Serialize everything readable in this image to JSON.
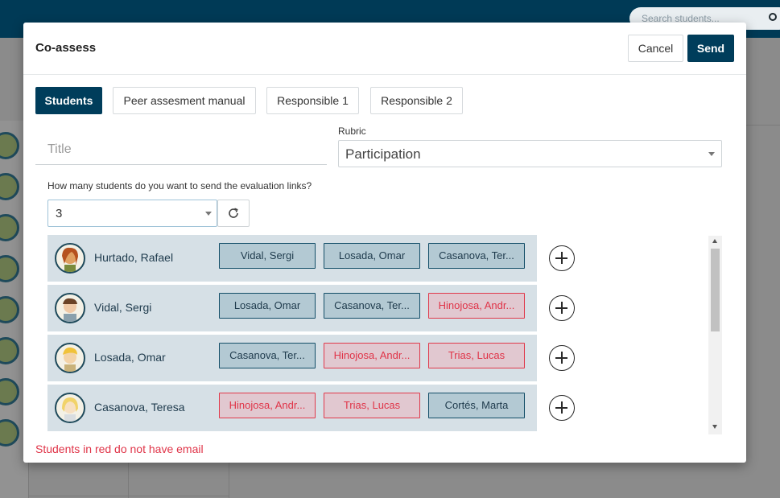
{
  "background": {
    "search_placeholder": "Search students..."
  },
  "modal": {
    "title": "Co-assess",
    "cancel_label": "Cancel",
    "send_label": "Send",
    "tabs": [
      {
        "label": "Students",
        "active": true
      },
      {
        "label": "Peer assesment manual",
        "active": false
      },
      {
        "label": "Responsible 1",
        "active": false
      },
      {
        "label": "Responsible 2",
        "active": false
      }
    ],
    "title_placeholder": "Title",
    "rubric_label": "Rubric",
    "rubric_value": "Participation",
    "question": "How many students do you want to send the evaluation links?",
    "count_value": "3",
    "students": [
      {
        "name": "Hurtado, Rafael",
        "links": [
          {
            "label": "Vidal, Sergi",
            "no_email": false
          },
          {
            "label": "Losada, Omar",
            "no_email": false
          },
          {
            "label": "Casanova, Ter...",
            "no_email": false
          }
        ]
      },
      {
        "name": "Vidal, Sergi",
        "links": [
          {
            "label": "Losada, Omar",
            "no_email": false
          },
          {
            "label": "Casanova, Ter...",
            "no_email": false
          },
          {
            "label": "Hinojosa, Andr...",
            "no_email": true
          }
        ]
      },
      {
        "name": "Losada, Omar",
        "links": [
          {
            "label": "Casanova, Ter...",
            "no_email": false
          },
          {
            "label": "Hinojosa, Andr...",
            "no_email": true
          },
          {
            "label": "Trias, Lucas",
            "no_email": true
          }
        ]
      },
      {
        "name": "Casanova, Teresa",
        "links": [
          {
            "label": "Hinojosa, Andr...",
            "no_email": true
          },
          {
            "label": "Trias, Lucas",
            "no_email": true
          },
          {
            "label": "Cortés, Marta",
            "no_email": false
          }
        ]
      }
    ],
    "footnote": "Students in red do not have email"
  },
  "colors": {
    "brand": "#003d5b",
    "row_bg": "#d6e0e6",
    "chip_bg": "#b3c9d3",
    "warning": "#e03448"
  },
  "icons": {
    "refresh": "refresh-icon",
    "add": "plus-circle-icon",
    "search": "search-icon"
  }
}
